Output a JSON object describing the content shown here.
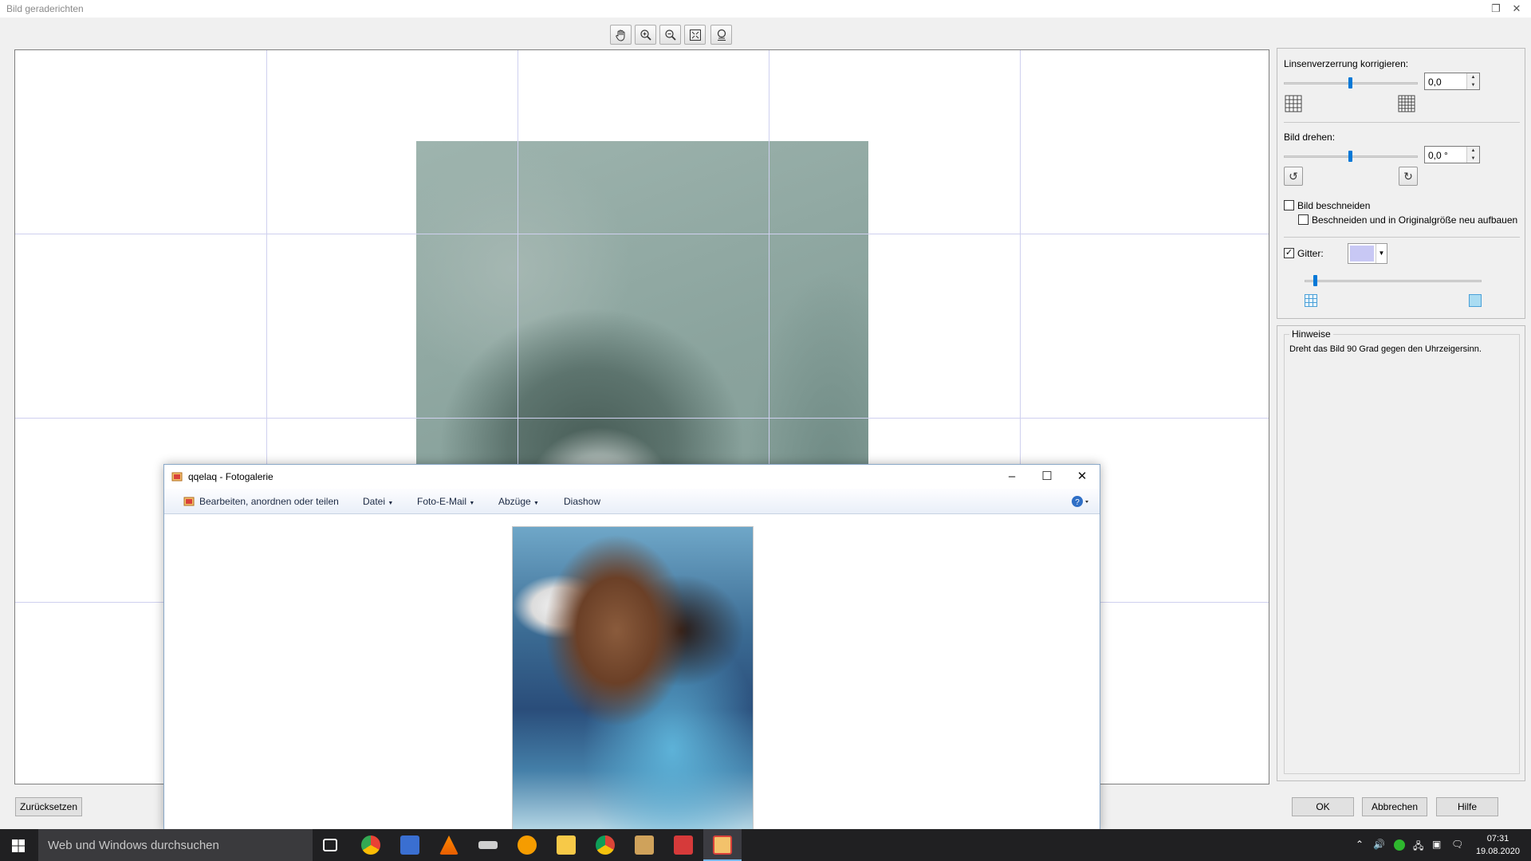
{
  "window": {
    "title": "Bild geraderichten"
  },
  "toolbar": {
    "tools": [
      "hand-tool",
      "zoom-in",
      "zoom-out",
      "fit-to-window",
      "zoom-100"
    ]
  },
  "panel": {
    "lens_label": "Linsenverzerrung korrigieren:",
    "lens_value": "0,0",
    "lens_slider": 0.5,
    "rotate_label": "Bild drehen:",
    "rotate_value": "0,0 °",
    "rotate_slider": 0.5,
    "crop_label": "Bild beschneiden",
    "crop_checked": false,
    "crop_rebuild_label": "Beschneiden und in Originalgröße neu aufbauen",
    "crop_rebuild_checked": false,
    "grid_label": "Gitter:",
    "grid_checked": true,
    "grid_color": "#c8c8f4",
    "grid_size_slider": 0.05
  },
  "hints": {
    "title": "Hinweise",
    "text": "Dreht das Bild 90 Grad gegen den Uhrzeigersinn."
  },
  "buttons": {
    "reset": "Zurücksetzen",
    "ok": "OK",
    "cancel": "Abbrechen",
    "help": "Hilfe"
  },
  "gallery": {
    "title": "qqelaq - Fotogalerie",
    "menu": {
      "edit": "Bearbeiten, anordnen oder teilen",
      "file": "Datei",
      "email": "Foto-E-Mail",
      "prints": "Abzüge",
      "slideshow": "Diashow"
    }
  },
  "taskbar": {
    "search_placeholder": "Web und Windows durchsuchen",
    "time": "07:31",
    "date": "19.08.2020"
  }
}
